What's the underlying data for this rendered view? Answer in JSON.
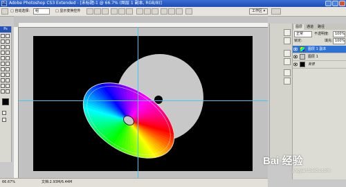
{
  "titlebar": {
    "app_icon": "Ps",
    "title": "Adobe Photoshop CS3 Extended - [未标题-1 @ 66.7% (图层 1 副本, RGB/8)]"
  },
  "options": {
    "feather_label": "□ 自动选择:",
    "group_value": "组",
    "transform_label": "□ 显示变换控件",
    "workspace_label": "工作区 ▾"
  },
  "toolbox": {
    "header": "Ps"
  },
  "statusbar": {
    "zoom": "66.67%",
    "doc_info": "文档:2.93M/6.44M"
  },
  "layers_panel": {
    "tabs": [
      "图层",
      "通道",
      "路径"
    ],
    "blend_mode": "正常",
    "opacity_label": "不透明度:",
    "opacity_value": "100%",
    "lock_label": "锁定:",
    "fill_label": "填充:",
    "fill_value": "100%",
    "layers": [
      {
        "name": "图层 1 副本",
        "selected": true
      },
      {
        "name": "图层 1",
        "selected": false
      },
      {
        "name": "背景",
        "selected": false
      }
    ]
  },
  "watermark": {
    "brand": "Bai 经验",
    "url": "jingyan.baidu.com"
  },
  "colors": {
    "canvas": "#000000",
    "guide": "#41c8ee",
    "disc_gray": "#c8c8c8",
    "selected_layer": "#2d73d6"
  }
}
